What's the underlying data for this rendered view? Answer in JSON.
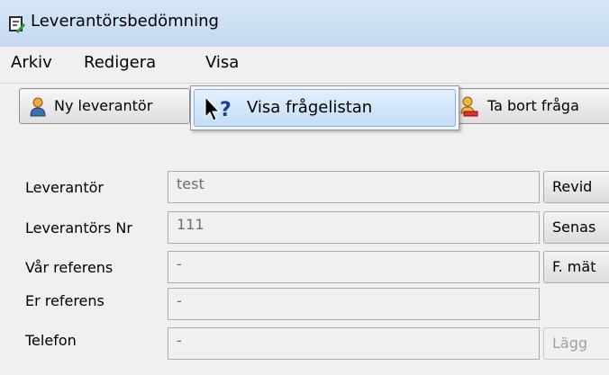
{
  "window": {
    "title": "Leverantörsbedömning"
  },
  "menu": [
    "Arkiv",
    "Redigera",
    "Visa"
  ],
  "toolbar": {
    "new_supplier": "Ny leverantör",
    "delete_question": "Ta bort fråga"
  },
  "dropdown": {
    "show_question_list": "Visa frågelistan"
  },
  "form": {
    "fields": [
      {
        "label": "Leverantör",
        "value": "test"
      },
      {
        "label": "Leverantörs Nr",
        "value": "111"
      },
      {
        "label": "Vår referens",
        "value": "-"
      },
      {
        "label": "Er referens",
        "value": "-"
      },
      {
        "label": "Telefon",
        "value": "-"
      }
    ],
    "side_buttons": [
      "Revid",
      "Senas",
      "F. mät",
      "Lägg"
    ]
  }
}
